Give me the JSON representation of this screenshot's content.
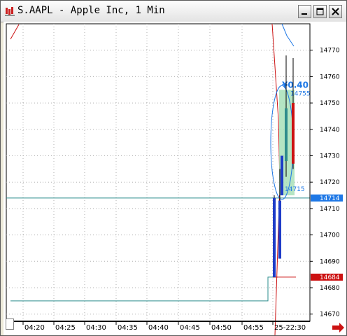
{
  "window": {
    "title": "S.AAPL - Apple Inc, 1 Min",
    "icon": "chart-app-icon",
    "buttons": [
      "minimize-icon",
      "maximize-icon",
      "close-icon"
    ]
  },
  "chart_data": {
    "type": "candlestick",
    "y_ticks": [
      "14770",
      "14760",
      "14750",
      "14740",
      "14730",
      "14720",
      "14710",
      "14700",
      "14690",
      "14680",
      "14670"
    ],
    "x_ticks": [
      "04:20",
      "04:25",
      "04:30",
      "04:35",
      "04:40",
      "04:45",
      "04:50",
      "04:55",
      "25-22:30"
    ],
    "ylim": [
      14665,
      14775
    ],
    "grid": true,
    "candles": [
      {
        "open": 14684,
        "high": 14715,
        "low": 14684,
        "close": 14714,
        "color": "#1e3cc8"
      },
      {
        "open": 14691,
        "high": 14725,
        "low": 14691,
        "close": 14713,
        "color": "#1e3cc8"
      },
      {
        "open": 14715,
        "high": 14730,
        "low": 14715,
        "close": 14730,
        "color": "#1e3cc8"
      },
      {
        "open": 14728,
        "high": 14768,
        "low": 14722,
        "close": 14748,
        "color": "#2f8c8c"
      },
      {
        "open": 14750,
        "high": 14767,
        "low": 14725,
        "close": 14727,
        "color": "#cc1111"
      }
    ],
    "last_price_label": "14714",
    "last_price_color": "#1e78e6",
    "low_price_label": "14684",
    "low_price_color": "#cc1111",
    "annotation": {
      "change": "¥0.40",
      "top": "14755",
      "bottom": "14715",
      "color": "#1e78e6"
    },
    "horizontal_level": 14714,
    "step_level": 14675
  }
}
